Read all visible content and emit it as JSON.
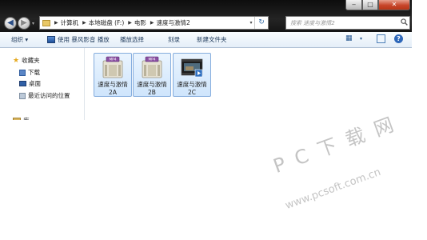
{
  "window": {
    "caption_buttons": {
      "minimize": "‒",
      "maximize": "□",
      "close": "✕"
    },
    "nav": {
      "back": "◀",
      "forward": "▶",
      "dropdown": "▾"
    },
    "address_bar": {
      "breadcrumbs": [
        "计算机",
        "本地磁盘 (F:)",
        "电影",
        "速度与激情2"
      ],
      "separator": "▶",
      "dropdown": "▾",
      "refresh": "↻"
    },
    "search": {
      "placeholder": "搜索 速度与激情2",
      "icon": "search-icon"
    }
  },
  "toolbar": {
    "organize": "组织 ▾",
    "open_with": "使用 暴风影音 播放",
    "play_selection": "播放选择",
    "burn": "刻录",
    "new_folder": "新建文件夹",
    "view": "▦",
    "view_drop": "▾",
    "help": "?"
  },
  "nav_pane": {
    "favorites": "收藏夹",
    "downloads": "下载",
    "desktop": "桌面",
    "recent": "最近访问的位置",
    "libraries": "库"
  },
  "files": [
    {
      "line1": "速度与激情",
      "line2": "2A",
      "badge": "MP4"
    },
    {
      "line1": "速度与激情",
      "line2": "2B",
      "badge": "MP4"
    },
    {
      "line1": "速度与激情",
      "line2": "2C"
    }
  ],
  "watermark": {
    "brand": "P C 下 载 网",
    "url": "www.pcsoft.com.cn"
  },
  "colors": {
    "title_bar": "#1a1a1a",
    "toolbar_text": "#1e395b",
    "selection": "#cfe5fc",
    "selection_border": "#84acdd",
    "watermark": "#c4c4c4"
  }
}
